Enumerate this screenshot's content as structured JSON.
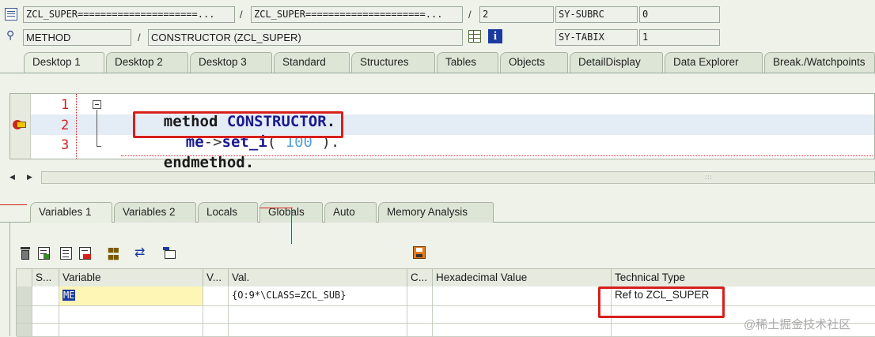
{
  "header": {
    "row1": {
      "program": "ZCL_SUPER=====================...",
      "include": "ZCL_SUPER=====================...",
      "line": "2",
      "sysfield_label": "SY-SUBRC",
      "sysfield_value": "0"
    },
    "row2": {
      "event_type": "METHOD",
      "event": "CONSTRUCTOR (ZCL_SUPER)",
      "sysfield_label": "SY-TABIX",
      "sysfield_value": "1"
    },
    "separator": "/"
  },
  "desktop_tabs": [
    "Desktop 1",
    "Desktop 2",
    "Desktop 3",
    "Standard",
    "Structures",
    "Tables",
    "Objects",
    "DetailDisplay",
    "Data Explorer",
    "Break./Watchpoints"
  ],
  "code": {
    "lines": [
      {
        "num": "1",
        "tokens": [
          {
            "t": "method",
            "c": "kw"
          },
          {
            "t": " CONSTRUCTOR",
            "c": "id"
          },
          {
            "t": ".",
            "c": "kw"
          }
        ]
      },
      {
        "num": "2",
        "tokens": [
          {
            "t": "me",
            "c": "kw"
          },
          {
            "t": "->",
            "c": "op"
          },
          {
            "t": "set",
            "c": "kw"
          },
          {
            "t": "_",
            "c": "kw"
          },
          {
            "t": "i",
            "c": "kw"
          },
          {
            "t": "( ",
            "c": "op"
          },
          {
            "t": "100",
            "c": "num"
          },
          {
            "t": " ).",
            "c": "op"
          }
        ]
      },
      {
        "num": "3",
        "tokens": [
          {
            "t": "endmethod",
            "c": "kw"
          },
          {
            "t": ".",
            "c": "kw"
          }
        ]
      }
    ]
  },
  "var_tabs": [
    "Variables 1",
    "Variables 2",
    "Locals",
    "Globals",
    "Auto",
    "Memory Analysis"
  ],
  "table": {
    "headers": [
      "S...",
      "Variable",
      "V...",
      "Val.",
      "C...",
      "Hexadecimal Value",
      "Technical Type"
    ],
    "rows": [
      {
        "variable": "ME",
        "value": "{O:9*\\CLASS=ZCL_SUB}",
        "technical_type": "Ref to ZCL_SUPER"
      }
    ]
  },
  "watermark": "@稀土掘金技术社区",
  "colors": {
    "accent_red": "#d6201c",
    "keyword": "#1b1b8f",
    "number": "#5aa0d8"
  }
}
